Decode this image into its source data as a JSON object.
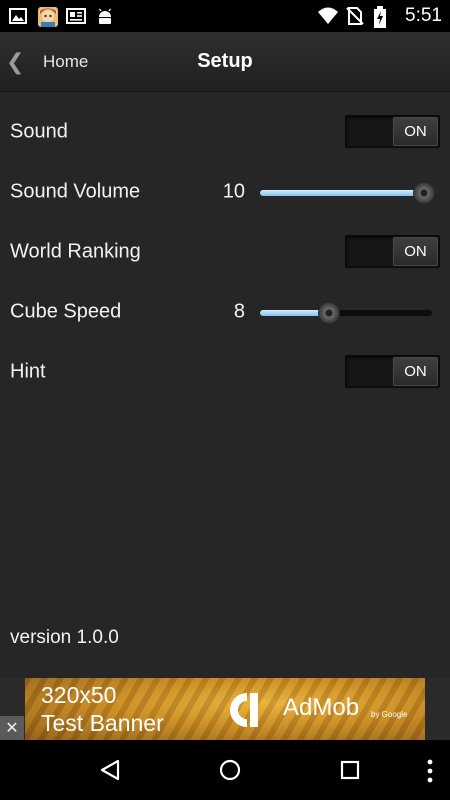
{
  "status_bar": {
    "time": "5:51",
    "icons": [
      "image-icon",
      "game-avatar-icon",
      "news-icon",
      "android-icon",
      "wifi-icon",
      "no-sim-icon",
      "battery-charging-icon"
    ]
  },
  "header": {
    "back_label": "Home",
    "title": "Setup"
  },
  "settings": {
    "sound": {
      "label": "Sound",
      "state": "ON"
    },
    "sound_volume": {
      "label": "Sound Volume",
      "value": "10",
      "fraction": 1.0
    },
    "world_ranking": {
      "label": "World Ranking",
      "state": "ON"
    },
    "cube_speed": {
      "label": "Cube Speed",
      "value": "8",
      "fraction": 0.4
    },
    "hint": {
      "label": "Hint",
      "state": "ON"
    }
  },
  "version": "version 1.0.0",
  "ad": {
    "line1": "320x50",
    "line2": "Test Banner",
    "brand": "AdMob",
    "brand_sub": "by Google",
    "close": "✕"
  },
  "colors": {
    "accent": "#8cc8f0",
    "panel": "#262626",
    "header": "#2a2b2d"
  }
}
